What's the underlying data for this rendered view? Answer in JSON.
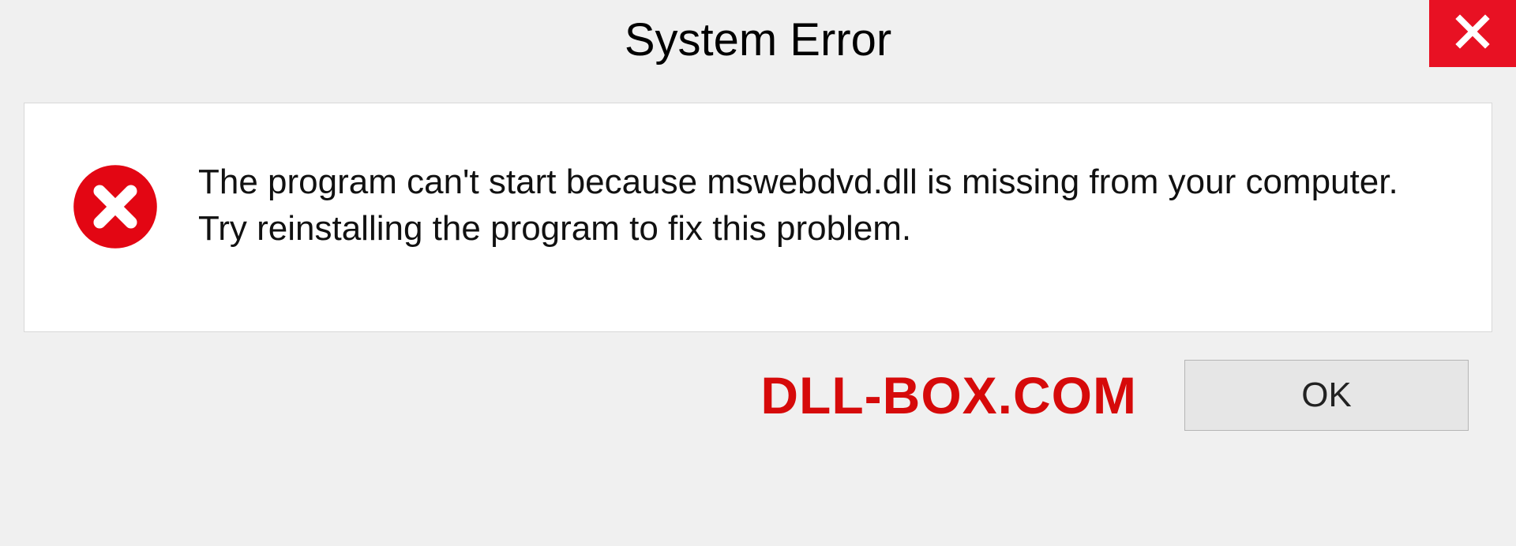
{
  "title": "System Error",
  "message": "The program can't start because mswebdvd.dll is missing from your computer. Try reinstalling the program to fix this problem.",
  "watermark": "DLL-BOX.COM",
  "ok_label": "OK"
}
